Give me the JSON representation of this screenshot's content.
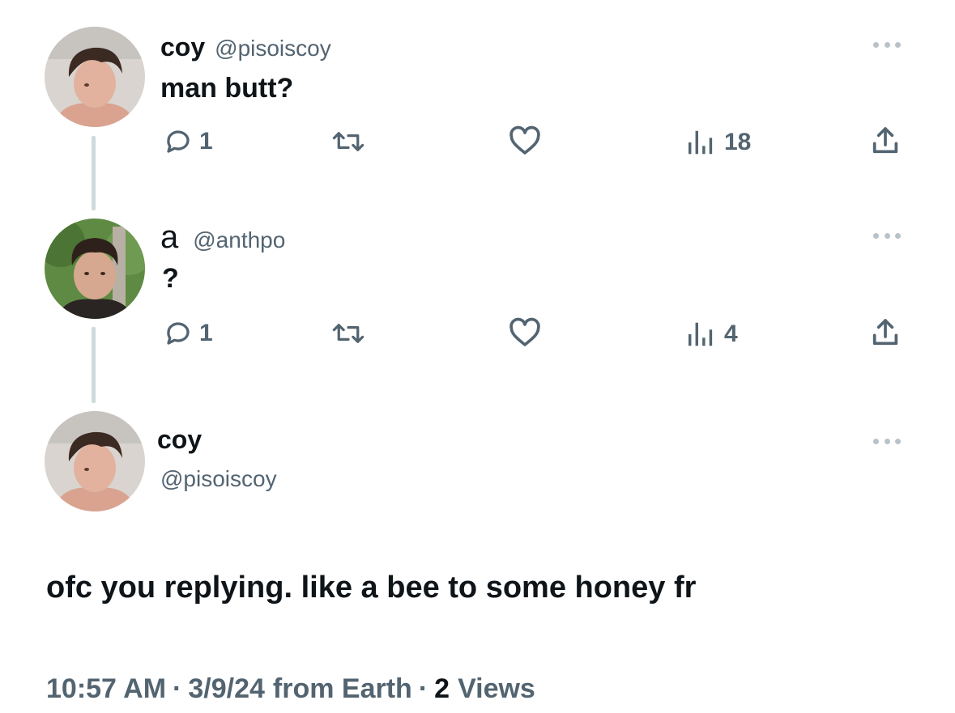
{
  "thread": [
    {
      "name": "coy",
      "handle": "@pisoiscoy",
      "text": "man butt?",
      "actions": {
        "replies": "1",
        "retweets": "",
        "likes": "",
        "views": "18"
      }
    },
    {
      "name": "a",
      "handle": "@anthpo",
      "text": "?",
      "actions": {
        "replies": "1",
        "retweets": "",
        "likes": "",
        "views": "4"
      }
    }
  ],
  "main_tweet": {
    "name": "coy",
    "handle": "@pisoiscoy",
    "text": "ofc you replying. like a bee to some honey fr",
    "time": "10:57 AM",
    "date": "3/9/24",
    "source": "from Earth",
    "views_count": "2",
    "views_label": "Views",
    "separator": "·"
  },
  "icons": [
    "reply-icon",
    "retweet-icon",
    "like-icon",
    "views-icon",
    "share-icon",
    "more-icon"
  ],
  "colors": {
    "text": "#0f1419",
    "secondary": "#536471",
    "thread_line": "#cfd9de"
  }
}
